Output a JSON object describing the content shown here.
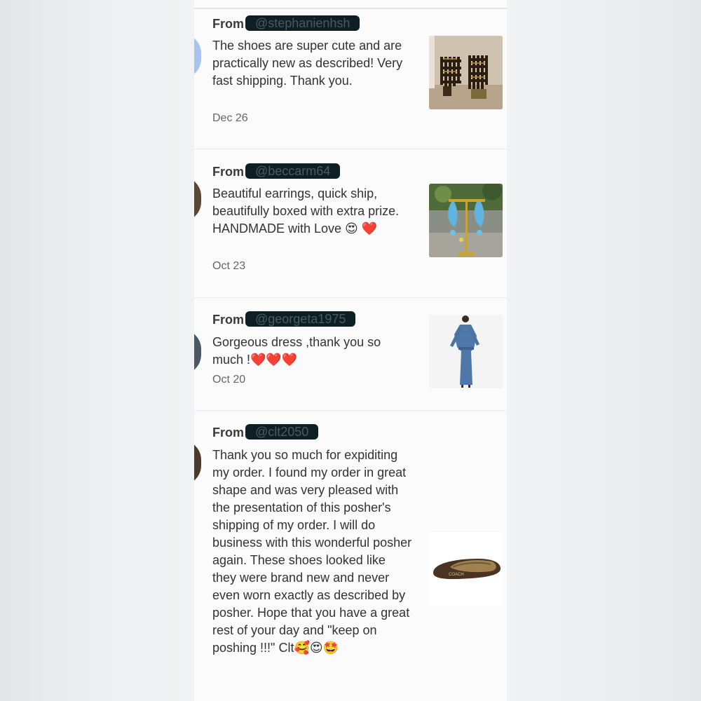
{
  "reviews": [
    {
      "from_label": "From",
      "handle": "@stephanienhsh",
      "text": "The shoes are super cute and are practically new as described! Very fast shipping. Thank you.",
      "date": "Dec 26",
      "product": "strappy-heels-image"
    },
    {
      "from_label": "From",
      "handle": "@beccarm64",
      "text": "Beautiful earrings, quick ship, beautifully boxed with extra prize. HANDMADE with Love 😍 ❤️",
      "date": "Oct 23",
      "product": "blue-earrings-image"
    },
    {
      "from_label": "From",
      "handle": "@georgeta1975",
      "text": "Gorgeous dress ,thank you so much !❤️❤️❤️",
      "date": "Oct 20",
      "product": "blue-dress-image"
    },
    {
      "from_label": "From",
      "handle": "@clt2050",
      "text": "Thank you so much for expiditing my order. I found my order in great shape and was very pleased with the presentation of this posher's shipping of my order. I will do business with this wonderful posher again. These shoes looked like they were brand new and never even worn exactly as described by posher. Hope that you have a great rest of your day and \"keep on poshing !!!\" Clt🥰😍🤩",
      "date": "",
      "product": "flat-shoe-image"
    }
  ],
  "colors": {
    "handle_redaction": "#0d1f24",
    "panel_background": "#fbfbfc",
    "text": "#333333"
  }
}
